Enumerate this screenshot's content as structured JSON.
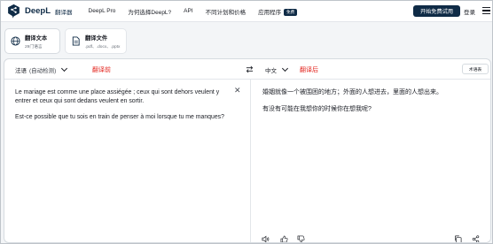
{
  "nav": {
    "brand": "DeepL",
    "brand_sub": "翻译器",
    "links": [
      "DeepL Pro",
      "为何选择DeepL?",
      "API",
      "不同计划和价格",
      "应用程序"
    ],
    "free_badge": "免费",
    "cta": "开始免费试用",
    "login": "登录"
  },
  "modes": [
    {
      "title": "翻译文本",
      "sub": "29门语言",
      "icon": "globe-icon",
      "active": true
    },
    {
      "title": "翻译文件",
      "sub": ".pdf、.docx、.pptx",
      "icon": "document-icon",
      "active": false
    }
  ],
  "source": {
    "lang_label": "法语",
    "lang_detect": "(自动检测)",
    "annotation": "翻译前",
    "paragraphs": [
      "Le mariage est comme une place assiégée ; ceux qui sont dehors veulent y entrer et ceux qui sont dedans veulent en sortir.",
      "Est-ce possible que tu sois en train de penser à moi lorsque tu me manques?"
    ]
  },
  "target": {
    "lang_label": "中文",
    "annotation": "翻译后",
    "glossary": "术语表",
    "paragraphs": [
      "婚姻就像一个被围困的地方；外面的人想进去，里面的人想出来。",
      "有没有可能在我想你的时候你在想我呢?"
    ]
  },
  "colors": {
    "brand_navy": "#0f2b46",
    "annotation_red": "#e3231c",
    "page_bg": "#f3f5f7"
  }
}
